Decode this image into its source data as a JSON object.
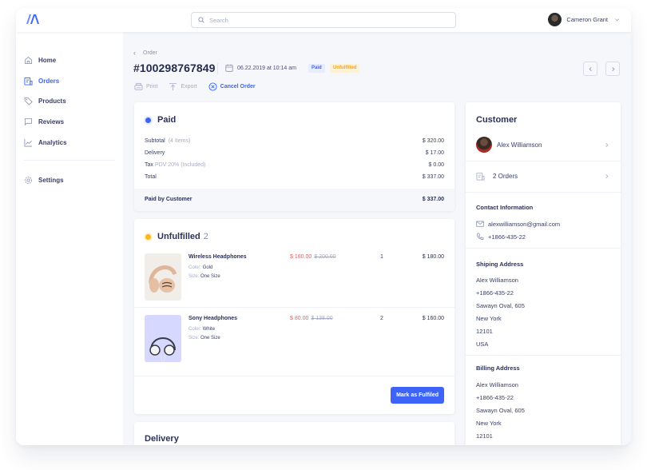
{
  "header": {
    "search_placeholder": "Search",
    "user_name": "Cameron Grant"
  },
  "sidebar": {
    "items": [
      {
        "label": "Home",
        "icon": "home-icon",
        "active": false
      },
      {
        "label": "Orders",
        "icon": "orders-icon",
        "active": true
      },
      {
        "label": "Products",
        "icon": "tag-icon",
        "active": false
      },
      {
        "label": "Reviews",
        "icon": "chat-icon",
        "active": false
      },
      {
        "label": "Analytics",
        "icon": "chart-icon",
        "active": false
      }
    ],
    "settings_label": "Settings"
  },
  "order": {
    "breadcrumb": "Order",
    "number": "#100298767849",
    "date": "06.22.2019 at 10:14 am",
    "badges": {
      "paid": "Paid",
      "unfulfilled": "Unfulfilled"
    },
    "actions": {
      "print": "Print",
      "export": "Export",
      "cancel": "Cancel Order"
    }
  },
  "paid_card": {
    "title": "Paid",
    "rows": [
      {
        "label": "Subtotal",
        "note": "(4 Items)",
        "value": "$ 320.00"
      },
      {
        "label": "Delivery",
        "note": "",
        "value": "$ 17.00"
      },
      {
        "label": "Tax",
        "note": "PDV 20% (Included)",
        "value": "$ 0.00"
      },
      {
        "label": "Total",
        "note": "",
        "value": "$ 337.00"
      }
    ],
    "paid_by_label": "Paid by Customer",
    "paid_by_value": "$ 337.00"
  },
  "unfulfilled_card": {
    "title": "Unfulfilled",
    "count": "2",
    "items": [
      {
        "name": "Wireless Headphones",
        "color_key": "Color:",
        "color": "Gold",
        "size_key": "Size:",
        "size": "One Size",
        "price": "$ 180.00",
        "old_price": "$ 200.00",
        "qty": "1",
        "total": "$ 180.00"
      },
      {
        "name": "Sony Headphones",
        "color_key": "Color:",
        "color": "White",
        "size_key": "Size:",
        "size": "One Size",
        "price": "$ 80.00",
        "old_price": "$ 138.00",
        "qty": "2",
        "total": "$ 160.00"
      }
    ],
    "button": "Mark as Fulfiled"
  },
  "delivery_card": {
    "title": "Delivery"
  },
  "customer": {
    "title": "Customer",
    "name": "Alex Williamson",
    "orders": "2 Orders",
    "contact_title": "Contact Information",
    "email": "alexwilliamson@gmail.com",
    "phone": "+1866-435-22",
    "shipping_title": "Shiping Address",
    "shipping": [
      "Alex Williamson",
      "+1866-435-22",
      "Sawayn Oval, 605",
      "New York",
      "12101",
      "USA"
    ],
    "billing_title": "Billing Address",
    "billing": [
      "Alex Williamson",
      "+1866-435-22",
      "Sawayn Oval, 605",
      "New York",
      "12101"
    ]
  },
  "colors": {
    "accent": "#3d64f6",
    "warning": "#f9b81a",
    "sale": "#f45b5b"
  }
}
